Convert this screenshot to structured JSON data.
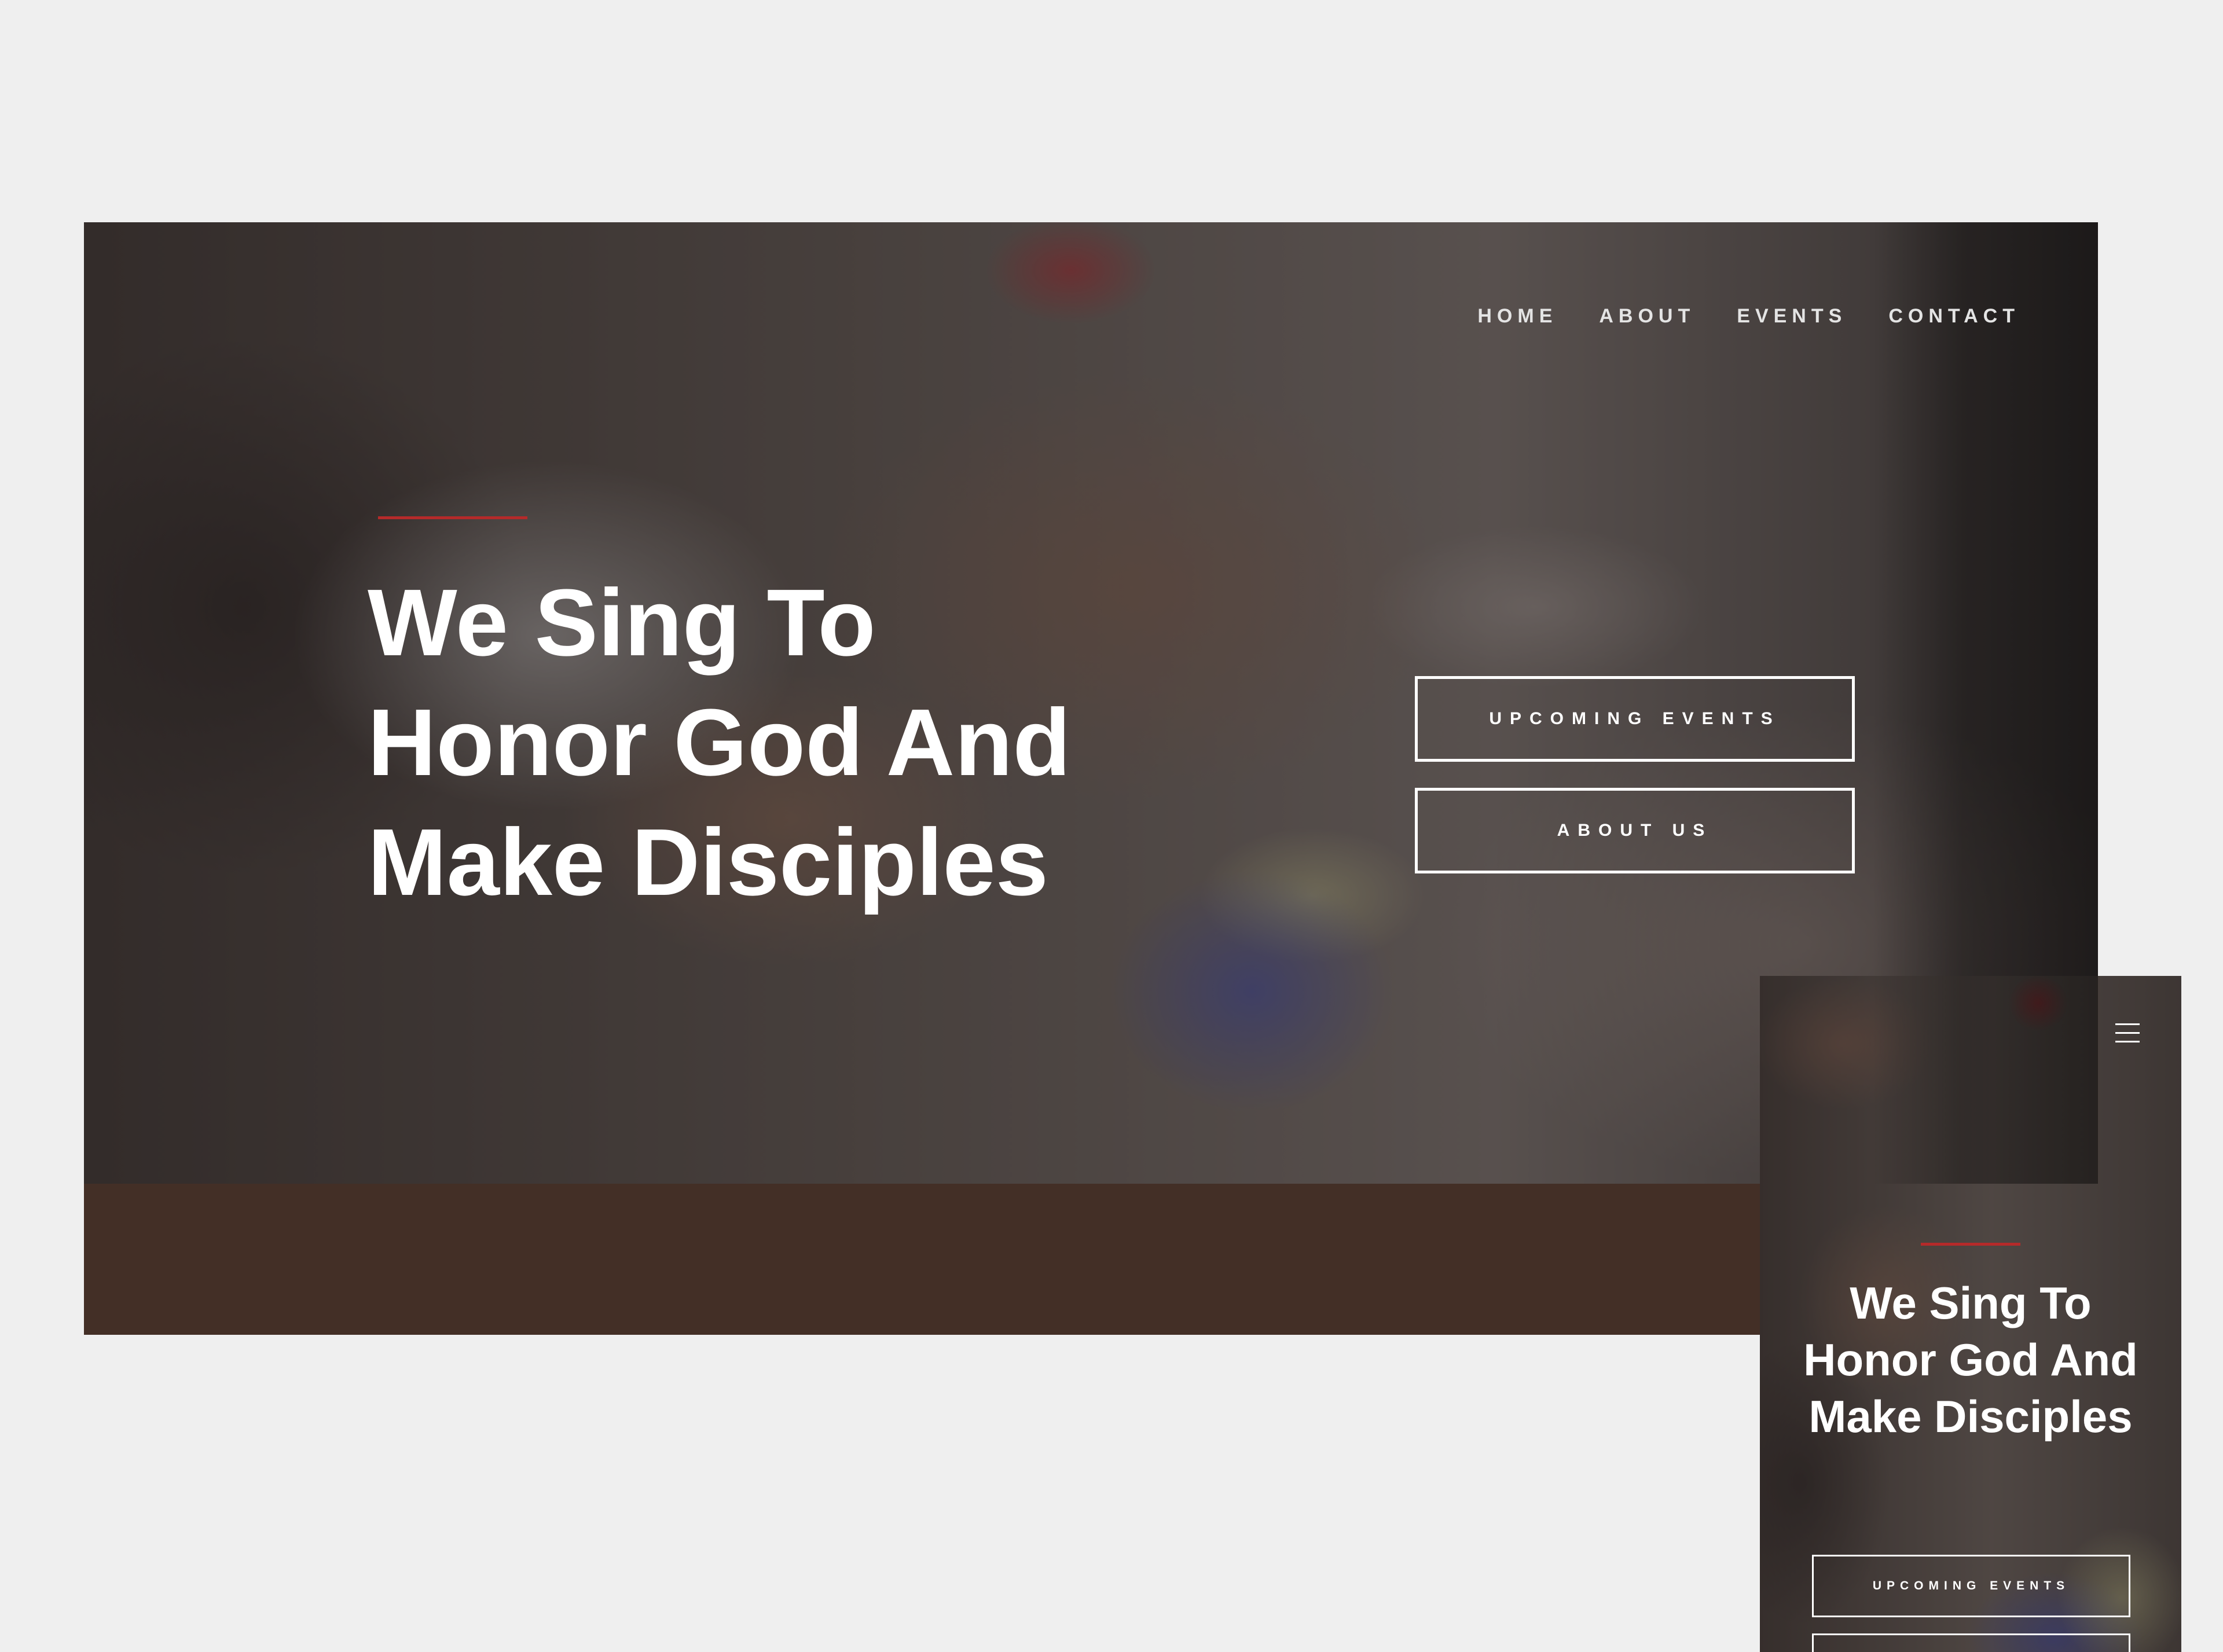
{
  "desktop": {
    "nav": {
      "items": [
        {
          "label": "HOME"
        },
        {
          "label": "ABOUT"
        },
        {
          "label": "EVENTS"
        },
        {
          "label": "CONTACT"
        }
      ]
    },
    "hero": {
      "title": "We Sing To Honor God And Make Disciples",
      "buttons": [
        {
          "label": "UPCOMING EVENTS"
        },
        {
          "label": "ABOUT US"
        }
      ]
    },
    "footer_band_color": "#432f26"
  },
  "mobile": {
    "menu_icon": "hamburger-menu-icon",
    "hero": {
      "title": "We Sing To Honor God And Make Disciples",
      "buttons": [
        {
          "label": "UPCOMING EVENTS"
        },
        {
          "label": ""
        }
      ]
    }
  },
  "colors": {
    "background": "#efefef",
    "accent": "#b52a2a",
    "text": "#ffffff"
  }
}
